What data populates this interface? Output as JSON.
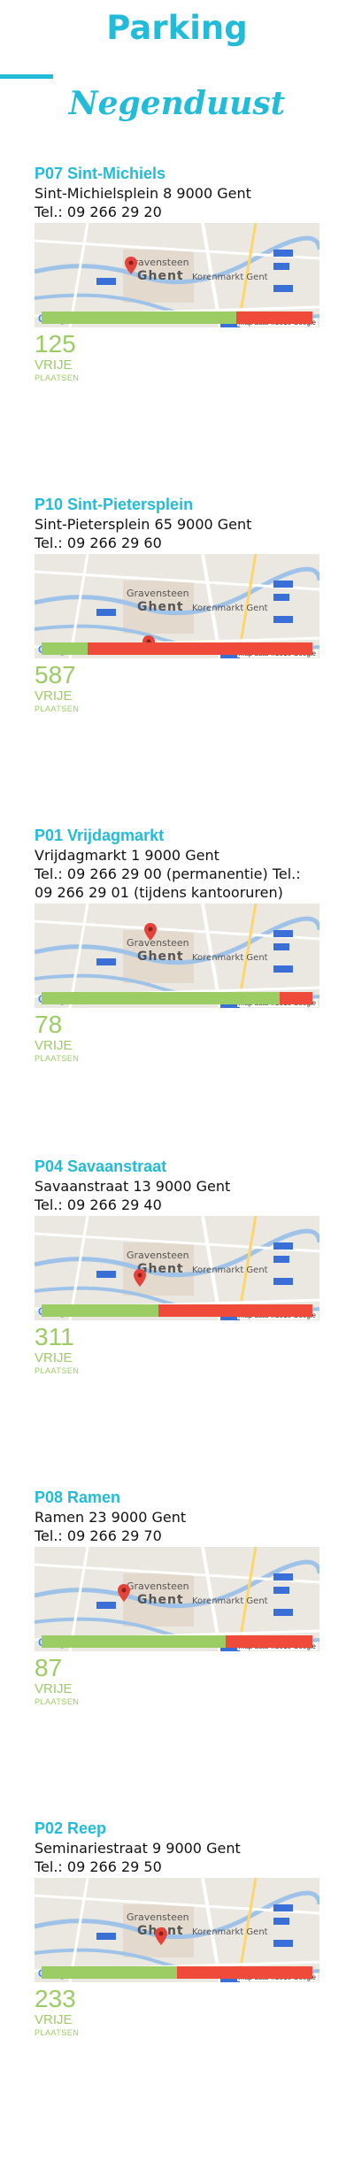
{
  "header": {
    "title": "Parking",
    "subtitle": "Negenduust"
  },
  "colors": {
    "accent": "#22bcd8",
    "free_color": "#9ccc64",
    "occupied_color": "#f04a3a"
  },
  "map": {
    "city_label": "Ghent",
    "landmark_label": "Korenmarkt Gent",
    "north_label": "Gravensteen",
    "attribution": "Map data ©2016 Google",
    "logo": "Google"
  },
  "labels": {
    "free": "VRIJE",
    "spots": "PLAATSEN"
  },
  "parkings": [
    {
      "name": "P07 Sint-Michiels",
      "address": "Sint-Michielsplein 8 9000 Gent",
      "phone": "Tel.: 09 266 29 20",
      "available": "125",
      "free_fraction": 0.72,
      "pin": "center"
    },
    {
      "name": "P10 Sint-Pietersplein",
      "address": "Sint-Pietersplein 65 9000 Gent",
      "phone": "Tel.: 09 266 29 60",
      "available": "587",
      "free_fraction": 0.17,
      "pin": "bottom"
    },
    {
      "name": "P01 Vrijdagmarkt",
      "address": "Vrijdagmarkt 1 9000 Gent",
      "phone": "Tel.: 09 266 29 00 (permanentie) Tel.: 09 266 29 01 (tijdens kantooruren)",
      "available": "78",
      "free_fraction": 0.88,
      "pin": "north"
    },
    {
      "name": "P04 Savaanstraat",
      "address": "Savaanstraat 13 9000 Gent",
      "phone": "Tel.: 09 266 29 40",
      "available": "311",
      "free_fraction": 0.43,
      "pin": "south"
    },
    {
      "name": "P08 Ramen",
      "address": "Ramen 23 9000 Gent",
      "phone": "Tel.: 09 266 29 70",
      "available": "87",
      "free_fraction": 0.68,
      "pin": "west"
    },
    {
      "name": "P02 Reep",
      "address": "Seminariestraat 9 9000 Gent",
      "phone": "Tel.: 09 266 29 50",
      "available": "233",
      "free_fraction": 0.5,
      "pin": "east"
    }
  ]
}
